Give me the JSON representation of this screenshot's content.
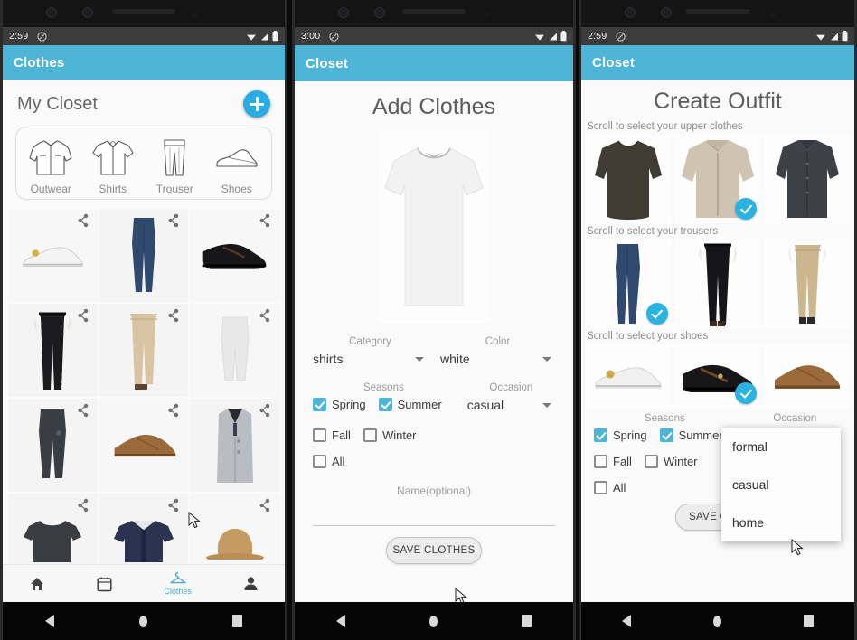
{
  "phones": [
    {
      "status": {
        "time": "2:59",
        "icons": [
          "do-not-disturb-icon",
          "wifi-icon",
          "signal-icon",
          "battery-icon"
        ]
      },
      "appbar": {
        "title": "Clothes"
      },
      "closet": {
        "heading": "My Closet",
        "add_button": "add-clothes-fab",
        "categories": [
          {
            "label": "Outwear",
            "icon": "jacket-icon"
          },
          {
            "label": "Shirts",
            "icon": "shirt-icon"
          },
          {
            "label": "Trouser",
            "icon": "trouser-icon"
          },
          {
            "label": "Shoes",
            "icon": "shoe-icon"
          }
        ],
        "items": [
          {
            "name": "white-sneaker",
            "type": "shoe",
            "color": "#f2f2f2"
          },
          {
            "name": "blue-jeans",
            "type": "trouser",
            "color": "#2f4a6e"
          },
          {
            "name": "black-loafer",
            "type": "shoe",
            "color": "#17171a"
          },
          {
            "name": "black-trouser",
            "type": "trouser",
            "color": "#1b1b1d"
          },
          {
            "name": "beige-chino",
            "type": "trouser",
            "color": "#d8c4a3"
          },
          {
            "name": "white-sweatpant",
            "type": "trouser",
            "color": "#e8e8e8"
          },
          {
            "name": "grey-jogger",
            "type": "trouser",
            "color": "#3a3d42"
          },
          {
            "name": "brown-brogue",
            "type": "shoe",
            "color": "#9a6a3a"
          },
          {
            "name": "grey-coat",
            "type": "outwear",
            "color": "#b9bcc1"
          },
          {
            "name": "dark-tshirt",
            "type": "shirt",
            "color": "#3a3d40"
          },
          {
            "name": "navy-shirt",
            "type": "shirt",
            "color": "#2b3350"
          },
          {
            "name": "tan-hat",
            "type": "accessory",
            "color": "#c59b63"
          }
        ]
      },
      "bottom_nav": [
        {
          "label": "",
          "icon": "home-icon",
          "active": false
        },
        {
          "label": "",
          "icon": "calendar-icon",
          "active": false
        },
        {
          "label": "Clothes",
          "icon": "hanger-icon",
          "active": true
        },
        {
          "label": "",
          "icon": "person-icon",
          "active": false
        }
      ]
    },
    {
      "status": {
        "time": "3:00"
      },
      "appbar": {
        "title": "Closet"
      },
      "page_title": "Add Clothes",
      "preview": {
        "name": "white-tshirt-preview"
      },
      "form": {
        "category": {
          "label": "Category",
          "value": "shirts"
        },
        "color": {
          "label": "Color",
          "value": "white"
        },
        "seasons": {
          "label": "Seasons",
          "options": [
            {
              "label": "Spring",
              "checked": true
            },
            {
              "label": "Summer",
              "checked": true
            },
            {
              "label": "Fall",
              "checked": false
            },
            {
              "label": "Winter",
              "checked": false
            },
            {
              "label": "All",
              "checked": false
            }
          ]
        },
        "occasion": {
          "label": "Occasion",
          "value": "casual"
        },
        "name": {
          "placeholder": "Name(optional)",
          "value": ""
        },
        "save_button": "SAVE CLOTHES"
      }
    },
    {
      "status": {
        "time": "2:59"
      },
      "appbar": {
        "title": "Closet"
      },
      "page_title": "Create Outfit",
      "sections": [
        {
          "hint": "Scroll to select your upper clothes",
          "items": [
            {
              "name": "dark-olive-longsleeve",
              "color": "#3f3c34",
              "selected": false
            },
            {
              "name": "beige-overshirt",
              "color": "#cfc4b2",
              "selected": true
            },
            {
              "name": "charcoal-dress-shirt",
              "color": "#3d4146",
              "selected": false
            }
          ]
        },
        {
          "hint": "Scroll to select your trousers",
          "items": [
            {
              "name": "blue-trouser",
              "color": "#2f4a6e",
              "selected": true
            },
            {
              "name": "black-trouser",
              "color": "#15151a",
              "selected": false
            },
            {
              "name": "khaki-trouser",
              "color": "#cbb68e",
              "selected": false
            }
          ]
        },
        {
          "hint": "Scroll to select your shoes",
          "items": [
            {
              "name": "white-sneaker",
              "color": "#f0f0f0",
              "selected": false
            },
            {
              "name": "black-loafer",
              "color": "#17171a",
              "selected": true
            },
            {
              "name": "brown-brogue",
              "color": "#9a6a3a",
              "selected": false
            }
          ]
        }
      ],
      "form": {
        "seasons": {
          "label": "Seasons",
          "options": [
            {
              "label": "Spring",
              "checked": true
            },
            {
              "label": "Summer",
              "checked": true
            },
            {
              "label": "Fall",
              "checked": false
            },
            {
              "label": "Winter",
              "checked": false
            },
            {
              "label": "All",
              "checked": false
            }
          ]
        },
        "occasion": {
          "label": "Occasion",
          "value": "",
          "open": true,
          "options": [
            "formal",
            "casual",
            "home"
          ]
        },
        "save_button": "SAVE OUTFIT"
      }
    }
  ],
  "android_nav": {
    "back": "back-icon",
    "home": "home-icon",
    "recents": "recents-icon"
  },
  "colors": {
    "accent": "#4fb5d6",
    "accent_dark": "#2ab3e0",
    "statusbar": "#3c3c3c",
    "screen_bg": "#fafafa"
  }
}
